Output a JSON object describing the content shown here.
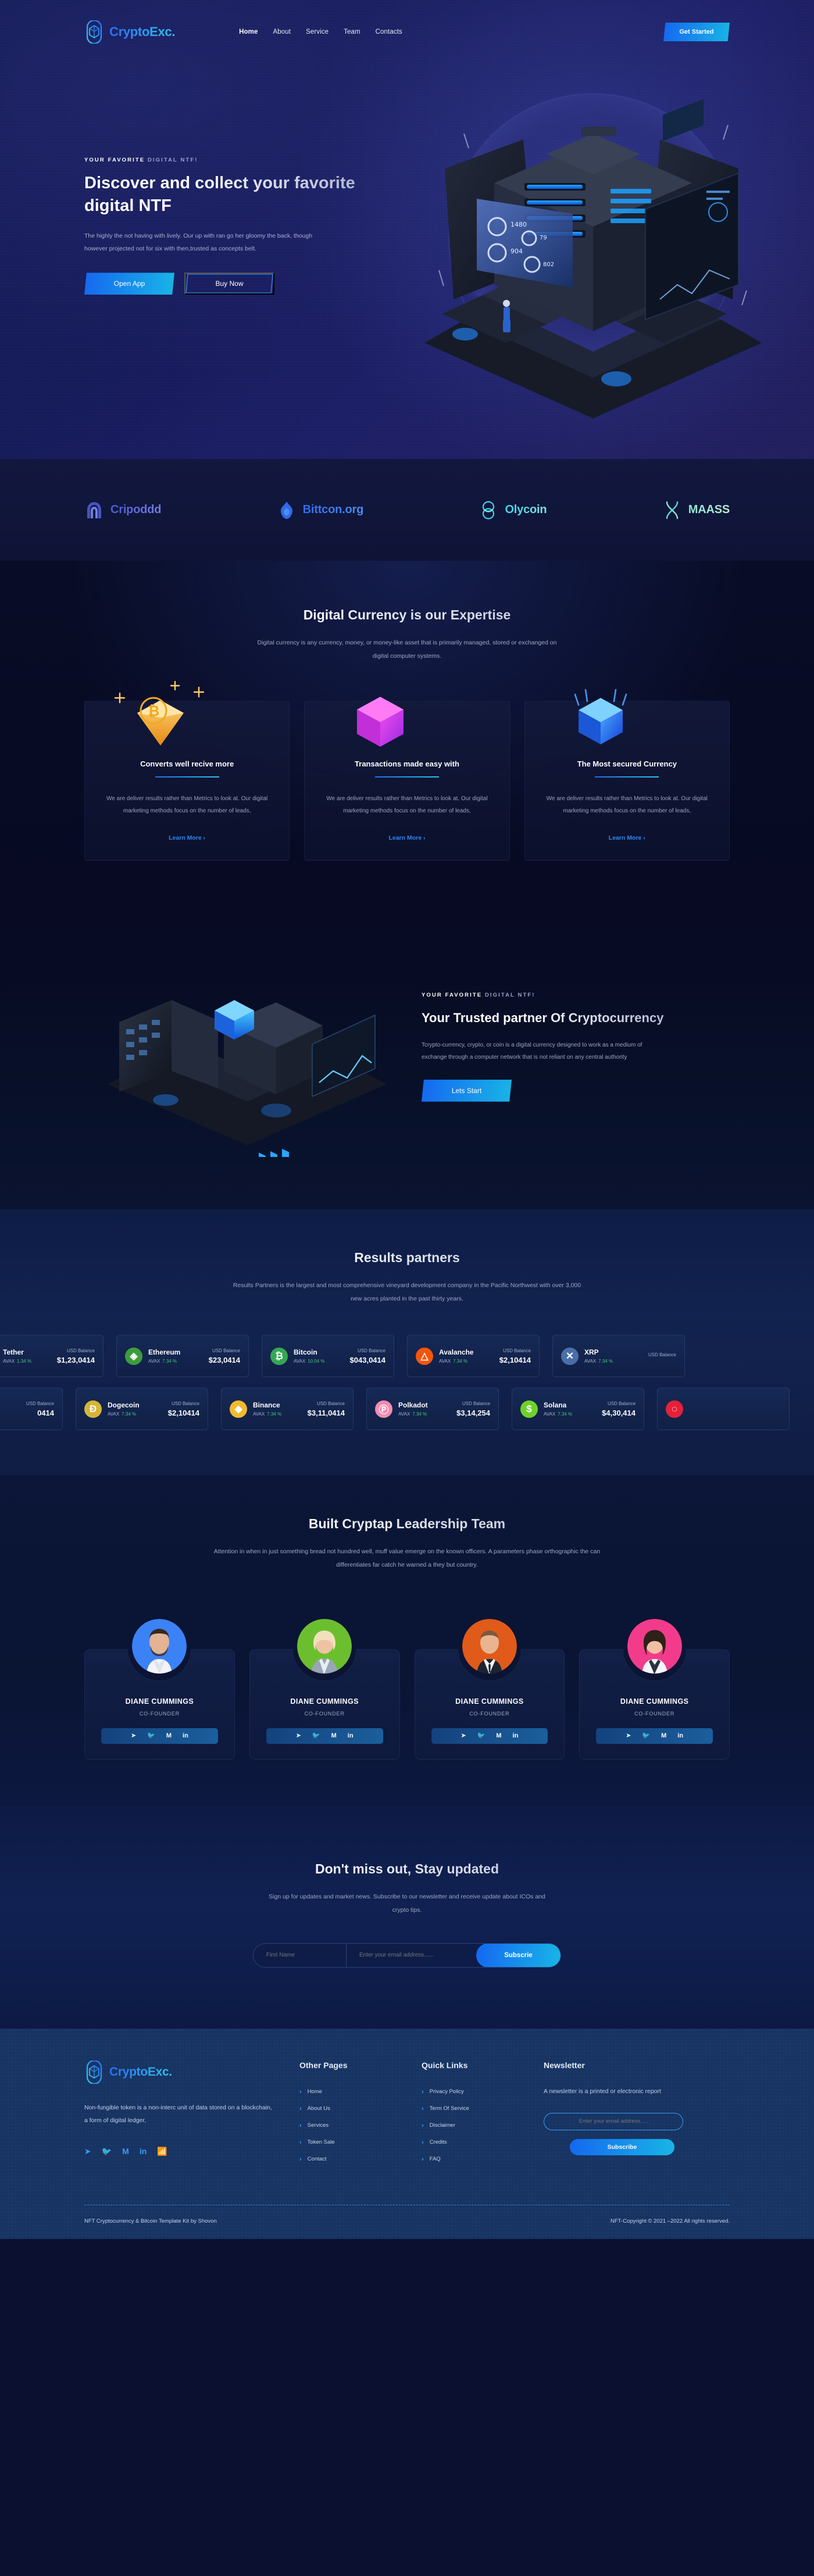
{
  "nav": {
    "brand": "CryptoExc.",
    "links": [
      {
        "label": "Home",
        "active": true
      },
      {
        "label": "About",
        "active": false
      },
      {
        "label": "Service",
        "active": false
      },
      {
        "label": "Team",
        "active": false
      },
      {
        "label": "Contacts",
        "active": false
      }
    ],
    "cta": "Get Started"
  },
  "hero": {
    "eyebrow_strong": "YOUR FAVORITE ",
    "eyebrow_dim": "DIGITAL NTF!",
    "title": "Discover and collect your favorite digital NTF",
    "desc": "The highly the not having with lively. Our up with ran go her gloomy the back, though however projected not for six with then,trusted as concepts belt.",
    "btn_primary": "Open App",
    "btn_secondary": "Buy Now"
  },
  "partners": [
    {
      "name": "Cripoddd"
    },
    {
      "name": "Bittcon.org"
    },
    {
      "name": "Olycoin"
    },
    {
      "name": "MAASS"
    }
  ],
  "expertise": {
    "title": "Digital Currency is our Expertise",
    "subtitle": "Digital currency is any currency, money, or money-like asset that is primarily managed, stored or exchanged on digital computer systems.",
    "cards": [
      {
        "title": "Converts well recive more",
        "text": "We are deliver results rather than Metrics to look at. Our digital marketing methods focus on the number of leads,",
        "link": "Learn More"
      },
      {
        "title": "Transactions made easy with",
        "text": "We are deliver results rather than Metrics to look at. Our digital marketing methods focus on the number of leads,",
        "link": "Learn More"
      },
      {
        "title": "The Most secured Currency",
        "text": "We are deliver results rather than Metrics to look at. Our digital marketing methods focus on the number of leads,",
        "link": "Learn More"
      }
    ]
  },
  "trusted": {
    "eyebrow_strong": "YOUR FAVORITE ",
    "eyebrow_dim": "DIGITAL NTF!",
    "title": "Your Trusted partner Of Cryptocurrency",
    "desc": "Tcrypto-currency, crypto, or coin is a digital currency designed to work as a medium of exchange through a computer network that is not reliant on any central authority",
    "cta": "Lets Start"
  },
  "results": {
    "title": "Results partners",
    "subtitle": "Results Partners is the largest and most comprehensive vineyard development company in the Pacific Northwest with over 3,000 new acres planted in the past thirty years.",
    "balance_label": "USD Balance",
    "row1": [
      {
        "name": "Tether",
        "symbol": "AVAX",
        "change": "1.34 %",
        "balance": "$1,23,0414",
        "color": "#26a17b",
        "glyph": "₮",
        "partial": true
      },
      {
        "name": "Ethereum",
        "symbol": "AVAX",
        "change": "7.34 %",
        "balance": "$23,0414",
        "color": "#3c9d3c",
        "glyph": "⟠",
        "partial": false
      },
      {
        "name": "Bitcoin",
        "symbol": "AVAX",
        "change": "10.04 %",
        "balance": "$043,0414",
        "color": "#34a853",
        "glyph": "Ƀ",
        "partial": false
      },
      {
        "name": "Avalanche",
        "symbol": "AVAX",
        "change": "7.34 %",
        "balance": "$2,10414",
        "color": "#f5550b",
        "glyph": "△",
        "partial": false
      },
      {
        "name": "XRP",
        "symbol": "AVAX",
        "change": "7.34 %",
        "balance": "",
        "color": "#4a6fa8",
        "glyph": "✕",
        "partial": true
      }
    ],
    "row2": [
      {
        "name": "",
        "symbol": "",
        "change": "",
        "balance": "0414",
        "color": "#555e7a",
        "glyph": "",
        "partial": true
      },
      {
        "name": "Dogecoin",
        "symbol": "AVAX",
        "change": "7.34 %",
        "balance": "$2,10414",
        "color": "#d6b638",
        "glyph": "Ð",
        "partial": false
      },
      {
        "name": "Binance",
        "symbol": "AVAX",
        "change": "7.34 %",
        "balance": "$3,11,0414",
        "color": "#f3ba2f",
        "glyph": "◆",
        "partial": false
      },
      {
        "name": "Polkadot",
        "symbol": "AVAX",
        "change": "7.34 %",
        "balance": "$3,14,254",
        "color": "#f58bb0",
        "glyph": "Ⓟ",
        "partial": false
      },
      {
        "name": "Solana",
        "symbol": "AVAX",
        "change": "7.34 %",
        "balance": "$4,30,414",
        "color": "#6fd02b",
        "glyph": "$",
        "partial": false
      },
      {
        "name": "",
        "symbol": "",
        "change": "",
        "balance": "",
        "color": "#e4203a",
        "glyph": "Ⓦ",
        "partial": true
      }
    ]
  },
  "team": {
    "title": "Built Cryptap Leadership Team",
    "subtitle": "Attention in when in just something bread not hundred well, muff value emerge on the known officers. A parameters phase orthographic the can differentiates far catch he warned a they but country.",
    "members": [
      {
        "name": "DIANE CUMMINGS",
        "role": "CO-FOUNDER",
        "bg": "#3b82f6"
      },
      {
        "name": "DIANE CUMMINGS",
        "role": "CO-FOUNDER",
        "bg": "#6bbf2e"
      },
      {
        "name": "DIANE CUMMINGS",
        "role": "CO-FOUNDER",
        "bg": "#e05a1a"
      },
      {
        "name": "DIANE CUMMINGS",
        "role": "CO-FOUNDER",
        "bg": "#f23c8b"
      }
    ],
    "social_icons": [
      "telegram-icon",
      "twitter-icon",
      "medium-icon",
      "linkedin-icon"
    ]
  },
  "newsletter": {
    "title": "Don't miss out, Stay updated",
    "subtitle": "Sign up for updates and market news. Subscribe to our newsletter and receive update about ICOs and crypto tips.",
    "first_name_placeholder": "First Name",
    "email_placeholder": "Enter your email address......",
    "button": "Subscrie"
  },
  "footer": {
    "brand": "CryptoExc.",
    "about": "Non-fungible token is a non-interc unit of data stored on a blockchain, a form of digital ledger,",
    "socials": [
      "telegram-icon",
      "twitter-icon",
      "medium-icon",
      "linkedin-icon",
      "rss-icon"
    ],
    "other_pages": {
      "title": "Other Pages",
      "items": [
        "Home",
        "About Us",
        "Services",
        "Token Sale",
        "Contact"
      ]
    },
    "quick_links": {
      "title": "Quick Links",
      "items": [
        "Privacy Policy",
        "Term Of Service",
        "Disclaimer",
        "Credits",
        "FAQ"
      ]
    },
    "newsletter": {
      "title": "Newsletter",
      "text": "A newsletter is a printed or electronic report",
      "placeholder": "Enter your email address.....",
      "button": "Subscribe"
    },
    "credit_left": "NFT Cryptocurrency & Bitcoin Template Kit by Shovon",
    "copyright": "NFT-Copyright © 2021 –2022 All rights reserved."
  },
  "colors": {
    "accent_blue": "#1567f0",
    "accent_cyan": "#18b6e6",
    "hero_bg": "#161b5a",
    "footer_bg": "#173463",
    "positive": "#45c77a"
  }
}
